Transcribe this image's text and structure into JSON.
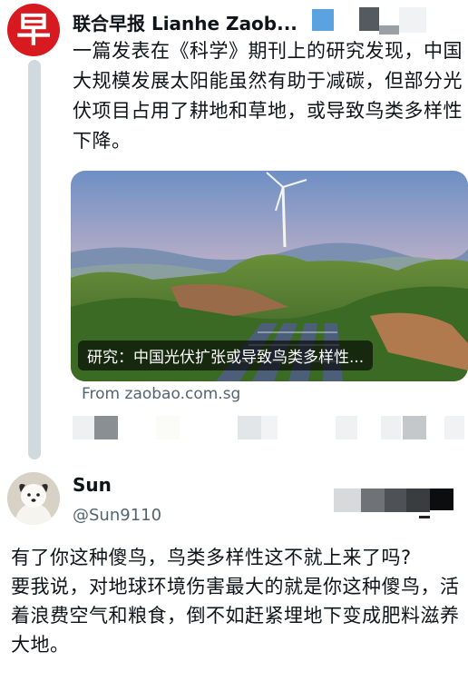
{
  "source_tweet": {
    "author_name": "联合早报 Lianhe Zaob...",
    "avatar_glyph": "早",
    "text": "一篇发表在《科学》期刊上的研究发现，中国大规模发展太阳能虽然有助于减碳，但部分光伏项目占用了耕地和草地，或导致鸟类多样性下降。",
    "link_card": {
      "title": "研究：中国光伏扩张或导致鸟类多样性...",
      "source": "From zaobao.com.sg"
    }
  },
  "reply_tweet": {
    "author_name": "Sun",
    "handle": "@Sun9110",
    "text_lines": [
      "有了你这种傻鸟，鸟类多样性这不就上来了吗?",
      "要我说，对地球环境伤害最大的就是你这种傻鸟，活着浪费空气和粮食，倒不如赶紧埋地下变成肥料滋养大地。"
    ]
  },
  "colors": {
    "logo_red": "#d71920",
    "thread_line": "#cfd9de",
    "secondary_text": "#536471"
  }
}
